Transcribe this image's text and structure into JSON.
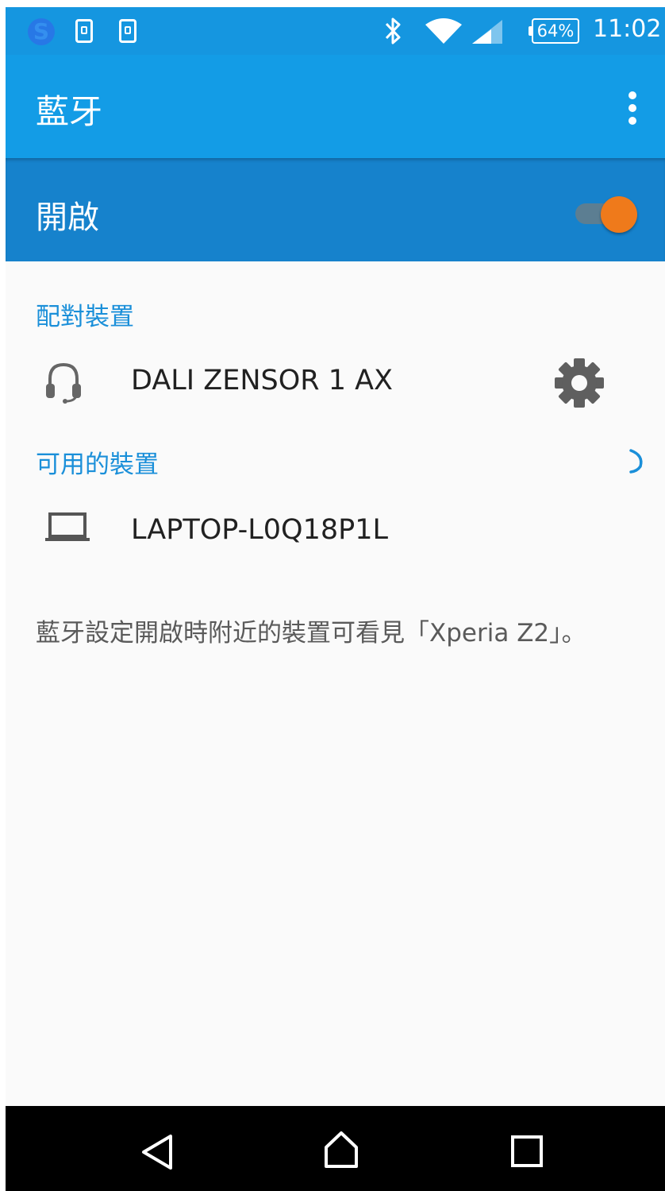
{
  "status_bar": {
    "icons": [
      "s-app-icon",
      "sync-app-icon",
      "screenshot-app-icon",
      "bluetooth-icon",
      "wifi-icon",
      "signal-icon"
    ],
    "battery": "64%",
    "time": "11:02"
  },
  "app_bar": {
    "title": "藍牙",
    "menu_icon": "more-vert-icon"
  },
  "switch_bar": {
    "label": "開啟",
    "checked": true,
    "thumb_color": "#ef7a1b"
  },
  "paired": {
    "header": "配對裝置",
    "devices": [
      {
        "name": "DALI ZENSOR 1 AX",
        "icon": "headset-icon",
        "settings_icon": "gear-icon"
      }
    ]
  },
  "available": {
    "header": "可用的裝置",
    "scanning_icon": "spinner-icon",
    "devices": [
      {
        "name": "LAPTOP-L0Q18P1L",
        "icon": "laptop-icon"
      }
    ]
  },
  "info": "藍牙設定開啟時附近的裝置可看見「Xperia Z2」。",
  "nav_bar": {
    "buttons": [
      "back-icon",
      "home-icon",
      "recents-icon"
    ]
  },
  "colors": {
    "status_bar": "#1596e0",
    "app_bar": "#139ce6",
    "switch_bar": "#1682cc",
    "accent": "#1a8fd9",
    "nav_bar": "#000000"
  }
}
